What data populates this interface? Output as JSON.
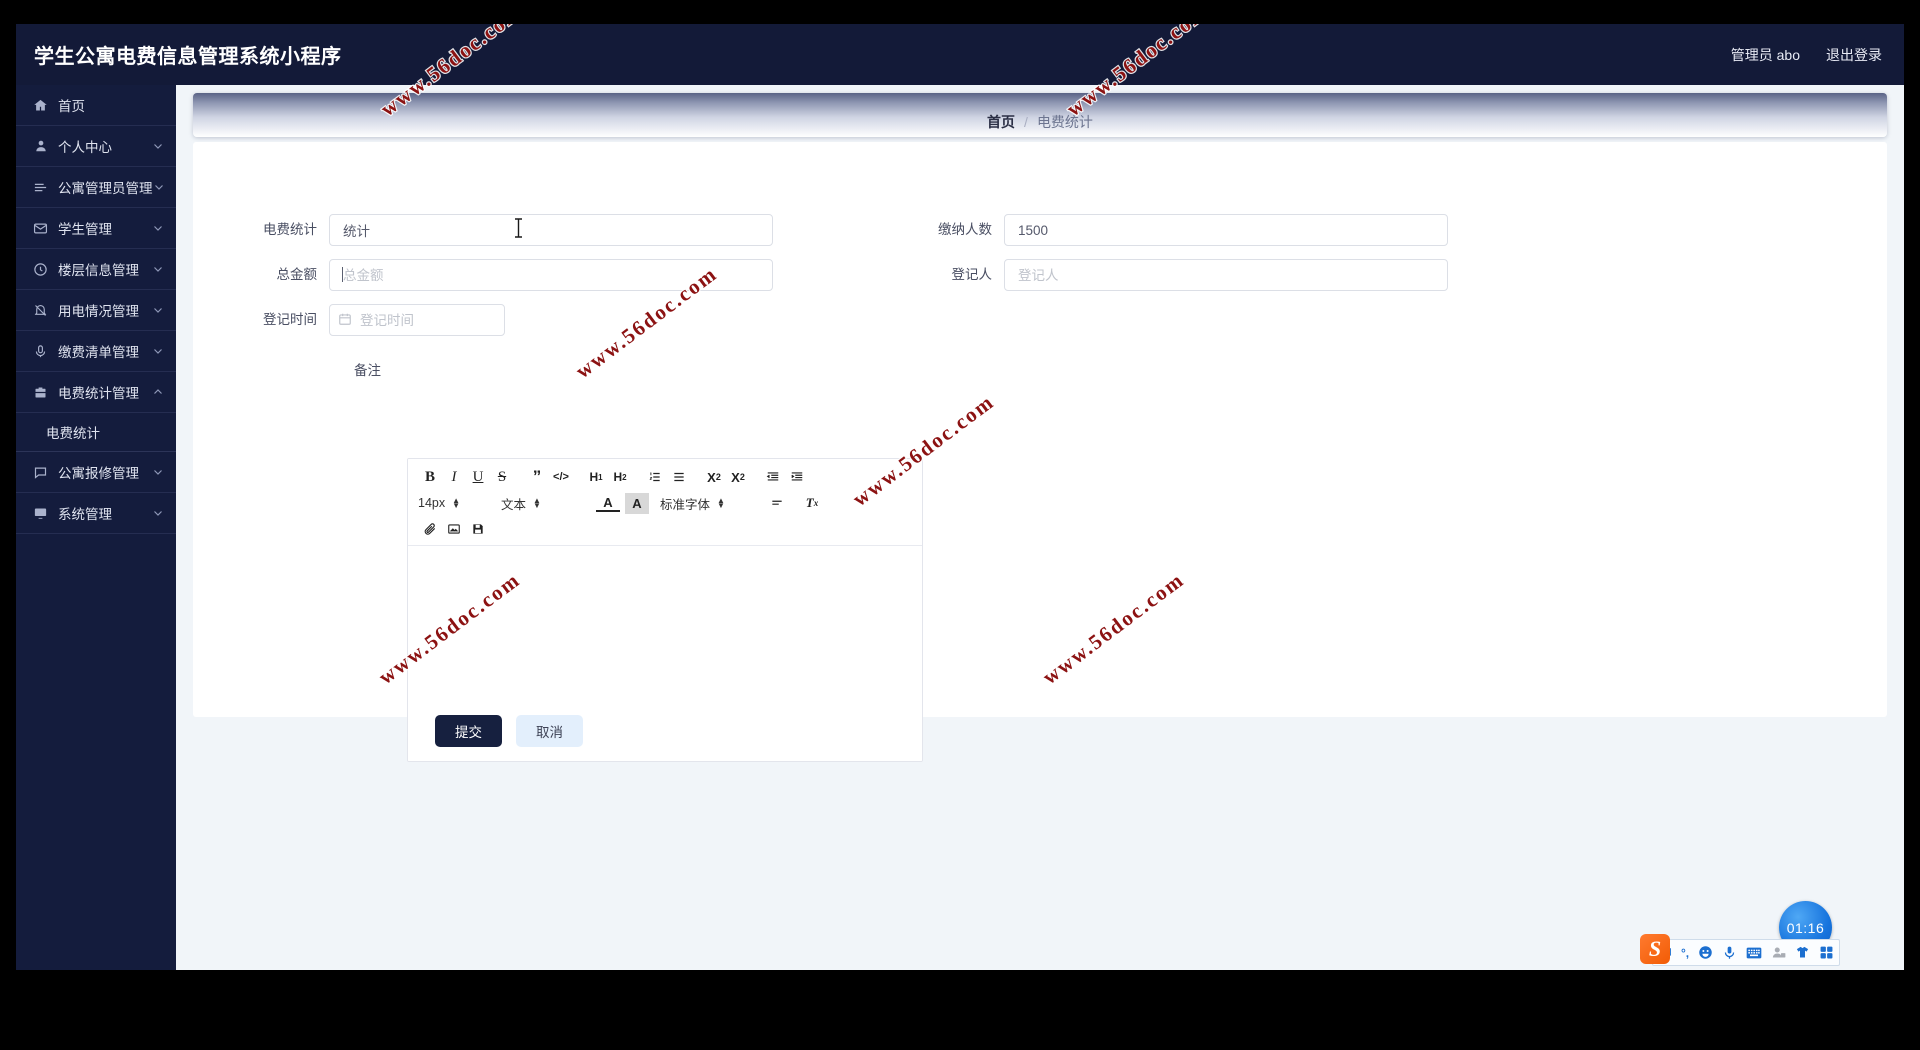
{
  "header": {
    "brand": "学生公寓电费信息管理系统小程序",
    "admin_label": "管理员 abo",
    "logout_label": "退出登录"
  },
  "sidebar": {
    "items": [
      {
        "label": "首页",
        "icon": "home-icon",
        "expandable": false
      },
      {
        "label": "个人中心",
        "icon": "user-icon",
        "expandable": true,
        "chevron": "down"
      },
      {
        "label": "公寓管理员管理",
        "icon": "list-icon",
        "expandable": true,
        "chevron": "down"
      },
      {
        "label": "学生管理",
        "icon": "mail-icon",
        "expandable": true,
        "chevron": "down"
      },
      {
        "label": "楼层信息管理",
        "icon": "clock-icon",
        "expandable": true,
        "chevron": "down"
      },
      {
        "label": "用电情况管理",
        "icon": "bell-off-icon",
        "expandable": true,
        "chevron": "down"
      },
      {
        "label": "缴费清单管理",
        "icon": "mic-icon",
        "expandable": true,
        "chevron": "down"
      },
      {
        "label": "电费统计管理",
        "icon": "briefcase-icon",
        "expandable": true,
        "chevron": "up",
        "children": [
          "电费统计"
        ]
      },
      {
        "label": "公寓报修管理",
        "icon": "message-icon",
        "expandable": true,
        "chevron": "down"
      },
      {
        "label": "系统管理",
        "icon": "monitor-icon",
        "expandable": true,
        "chevron": "down"
      }
    ],
    "submenu_electric": "电费统计"
  },
  "breadcrumb": {
    "home": "首页",
    "separator": "/",
    "current": "电费统计"
  },
  "form": {
    "fields": {
      "stat_name": {
        "label": "电费统计",
        "value": "统计",
        "placeholder": "电费统计"
      },
      "pay_count": {
        "label": "缴纳人数",
        "value": "1500",
        "placeholder": "缴纳人数"
      },
      "total_amount": {
        "label": "总金额",
        "value": "",
        "placeholder": "总金额"
      },
      "registrant": {
        "label": "登记人",
        "value": "",
        "placeholder": "登记人"
      },
      "register_time": {
        "label": "登记时间",
        "value": "",
        "placeholder": "登记时间"
      },
      "remark": {
        "label": "备注",
        "value": ""
      }
    },
    "buttons": {
      "submit": "提交",
      "cancel": "取消"
    }
  },
  "editor": {
    "toolbar_row1": [
      {
        "name": "bold-icon",
        "glyph": "B"
      },
      {
        "name": "italic-icon",
        "glyph": "I"
      },
      {
        "name": "underline-icon",
        "glyph": "U"
      },
      {
        "name": "strikethrough-icon",
        "glyph": "S"
      },
      {
        "name": "blockquote-icon",
        "glyph": "”"
      },
      {
        "name": "code-icon",
        "glyph": "</>"
      },
      {
        "name": "heading-1-icon",
        "glyph": "H1"
      },
      {
        "name": "heading-2-icon",
        "glyph": "H2"
      },
      {
        "name": "ordered-list-icon",
        "glyph": "list-ol"
      },
      {
        "name": "unordered-list-icon",
        "glyph": "list-ul"
      },
      {
        "name": "subscript-icon",
        "glyph": "X2"
      },
      {
        "name": "superscript-icon",
        "glyph": "X^2"
      },
      {
        "name": "outdent-icon",
        "glyph": "indent-left"
      },
      {
        "name": "indent-icon",
        "glyph": "indent-right"
      }
    ],
    "font_size": "14px",
    "block_type": "文本",
    "font_family": "标准字体",
    "toolbar_row2": [
      {
        "name": "text-color-icon",
        "glyph": "A"
      },
      {
        "name": "background-color-icon",
        "glyph": "A-bg"
      },
      {
        "name": "align-icon",
        "glyph": "align"
      },
      {
        "name": "clear-format-icon",
        "glyph": "Tx"
      }
    ],
    "toolbar_row3": [
      {
        "name": "attachment-icon",
        "glyph": "paperclip"
      },
      {
        "name": "insert-image-icon",
        "glyph": "image"
      },
      {
        "name": "save-icon",
        "glyph": "floppy"
      }
    ],
    "content": ""
  },
  "watermark": {
    "text": "www.56doc.com"
  },
  "taskbar": {
    "ime_name": "S",
    "ime_items": [
      {
        "name": "ime-chinese-mode",
        "glyph": "中"
      },
      {
        "name": "ime-punctuation-mode",
        "glyph": "°,"
      },
      {
        "name": "ime-emoji-icon",
        "glyph": "emoji"
      },
      {
        "name": "ime-voice-input-icon",
        "glyph": "mic"
      },
      {
        "name": "ime-soft-keyboard-icon",
        "glyph": "keyboard"
      },
      {
        "name": "ime-user-icon",
        "glyph": "user"
      },
      {
        "name": "ime-skin-icon",
        "glyph": "shirt"
      },
      {
        "name": "ime-toolbox-icon",
        "glyph": "grid"
      }
    ],
    "floating_timer": "01:16"
  }
}
